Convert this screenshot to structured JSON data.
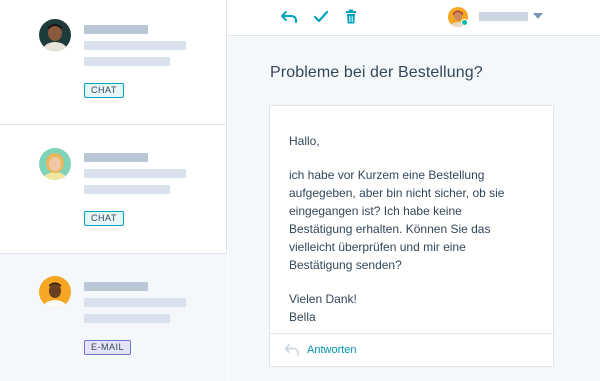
{
  "conversations": [
    {
      "channel": "CHAT"
    },
    {
      "channel": "CHAT"
    },
    {
      "channel": "E-MAIL"
    }
  ],
  "toolbar": {
    "icons": [
      "reply-icon",
      "check-icon",
      "trash-icon"
    ],
    "owner_caret": "chevron-down-icon"
  },
  "email": {
    "subject": "Probleme bei der Bestellung?",
    "greeting": "Hallo,",
    "body_lines": [
      "ich habe vor Kurzem eine Bestellung",
      "aufgegeben, aber bin nicht sicher, ob sie",
      "eingegangen ist? Ich habe keine",
      "Bestätigung erhalten. Können Sie das",
      "vielleicht überprüfen und mir eine",
      "Bestätigung senden?"
    ],
    "closing": "Vielen Dank!",
    "signature": "Bella",
    "reply_label": "Antworten"
  },
  "colors": {
    "accent": "#00a4bd",
    "link": "#0091ae",
    "chat_badge_border": "#00a4bd",
    "email_badge_border": "#6a78d1",
    "online_status": "#00bda5"
  }
}
